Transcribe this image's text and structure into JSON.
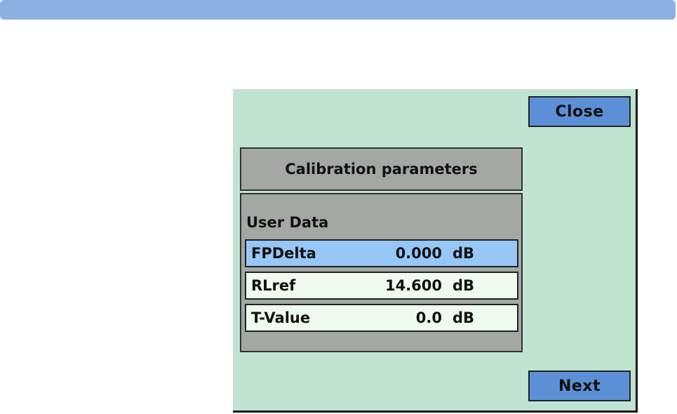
{
  "buttons": {
    "close_label": "Close",
    "next_label": "Next"
  },
  "panel": {
    "title": "Calibration parameters",
    "section_label": "User Data",
    "rows": [
      {
        "name": "FPDelta",
        "value": "0.000",
        "unit": "dB",
        "selected": true
      },
      {
        "name": "RLref",
        "value": "14.600",
        "unit": "dB",
        "selected": false
      },
      {
        "name": "T-Value",
        "value": "0.0",
        "unit": "dB",
        "selected": false
      }
    ]
  },
  "colors": {
    "top_bar": "#8db0e3",
    "screen_background": "#c0e3d2",
    "button": "#5b8fd6",
    "panel": "#a3a8a5",
    "row": "#eefbee",
    "row_selected": "#96c7f6"
  }
}
